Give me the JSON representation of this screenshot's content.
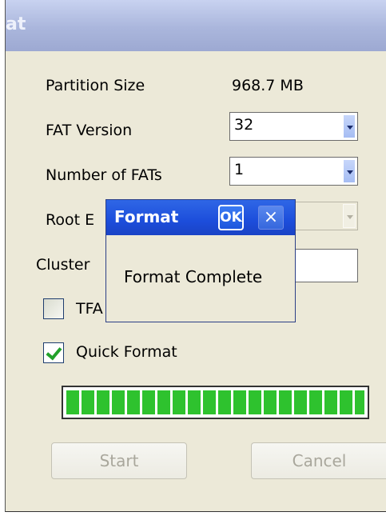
{
  "window": {
    "title": "at"
  },
  "fields": {
    "partition_label": "Partition Size",
    "partition_value": "968.7 MB",
    "fat_version_label": "FAT Version",
    "fat_version_value": "32",
    "num_fats_label": "Number of FATs",
    "num_fats_value": "1",
    "root_label": "Root E",
    "cluster_label": "Cluster"
  },
  "checkboxes": {
    "tfat_label": "TFA",
    "tfat_checked": false,
    "quick_label": "Quick Format",
    "quick_checked": true
  },
  "progress": {
    "percent": 100
  },
  "buttons": {
    "start": "Start",
    "cancel": "Cancel"
  },
  "popup": {
    "title": "Format",
    "ok": "OK",
    "close": "×",
    "message": "Format Complete"
  },
  "colors": {
    "popup_title_bar": "#1c4ddb",
    "progress_fill": "#2ec22e",
    "checkmark": "#22a12a"
  }
}
